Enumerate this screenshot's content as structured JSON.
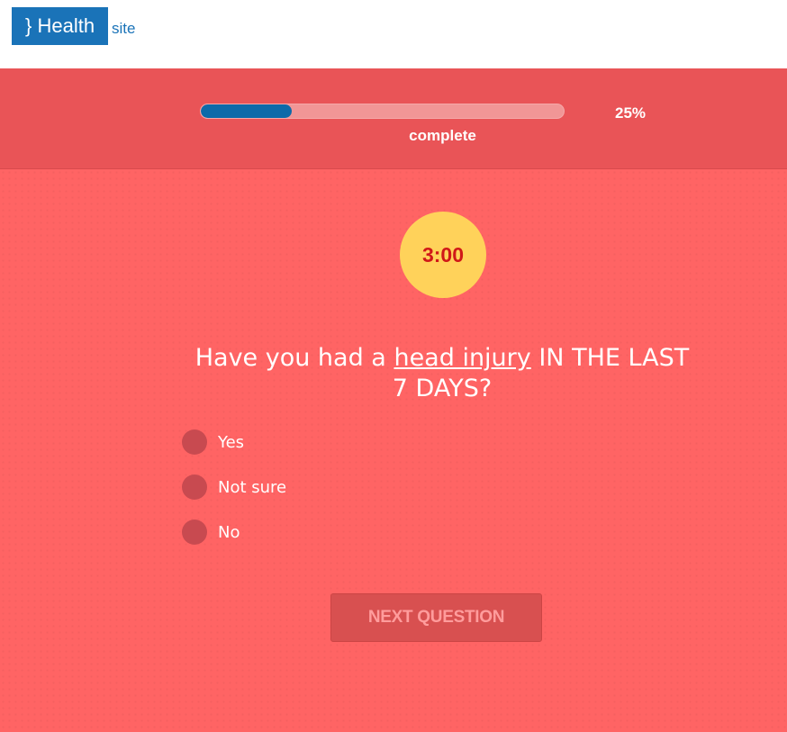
{
  "header": {
    "logo_text": "} Health",
    "site_label": "site",
    "brand_color": "#1a73b8"
  },
  "progress": {
    "percent_value": 25,
    "percent_label": "25%",
    "caption": "complete",
    "fill_color": "#0d6aa9"
  },
  "timer": {
    "value": "3:00",
    "color": "#ffd25a"
  },
  "question": {
    "prefix": "Have you had a ",
    "link_text": "head injury",
    "suffix": " IN THE LAST 7 DAYS?"
  },
  "options": [
    {
      "label": "Yes"
    },
    {
      "label": "Not sure"
    },
    {
      "label": "No"
    }
  ],
  "next_button": {
    "label": "NEXT QUESTION"
  },
  "colors": {
    "band": "#e95457",
    "quiz_background": "#ff6464",
    "radio": "#c84a50"
  }
}
